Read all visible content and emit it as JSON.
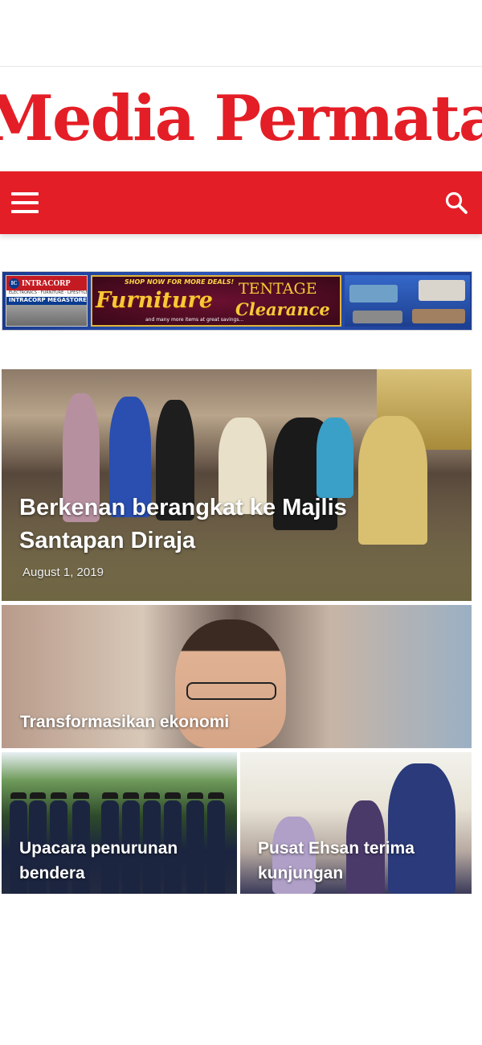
{
  "site": {
    "name": "Media Permata",
    "brand_color": "#e41e26"
  },
  "nav": {
    "menu_icon": "hamburger-icon",
    "search_icon": "search-icon"
  },
  "ad": {
    "brand_top": "INTRACORP",
    "brand_logo": "IC",
    "brand_sub": "ELECTRONICS · FURNITURE · LIFESTYLE",
    "brand_store": "INTRACORP MEGASTORE",
    "shop_text": "SHOP NOW FOR MORE DEALS!",
    "headline": "Furniture",
    "tent": "TENTAGE",
    "clearance": "Clearance",
    "more": "and many more items at great savings..."
  },
  "articles": [
    {
      "title": "Berkenan berangkat ke Majlis Santapan Diraja",
      "date": "August 1, 2019"
    },
    {
      "title": "Transformasikan ekonomi"
    },
    {
      "title": "Upacara penurunan bendera"
    },
    {
      "title": "Pusat Ehsan terima kunjungan"
    }
  ]
}
